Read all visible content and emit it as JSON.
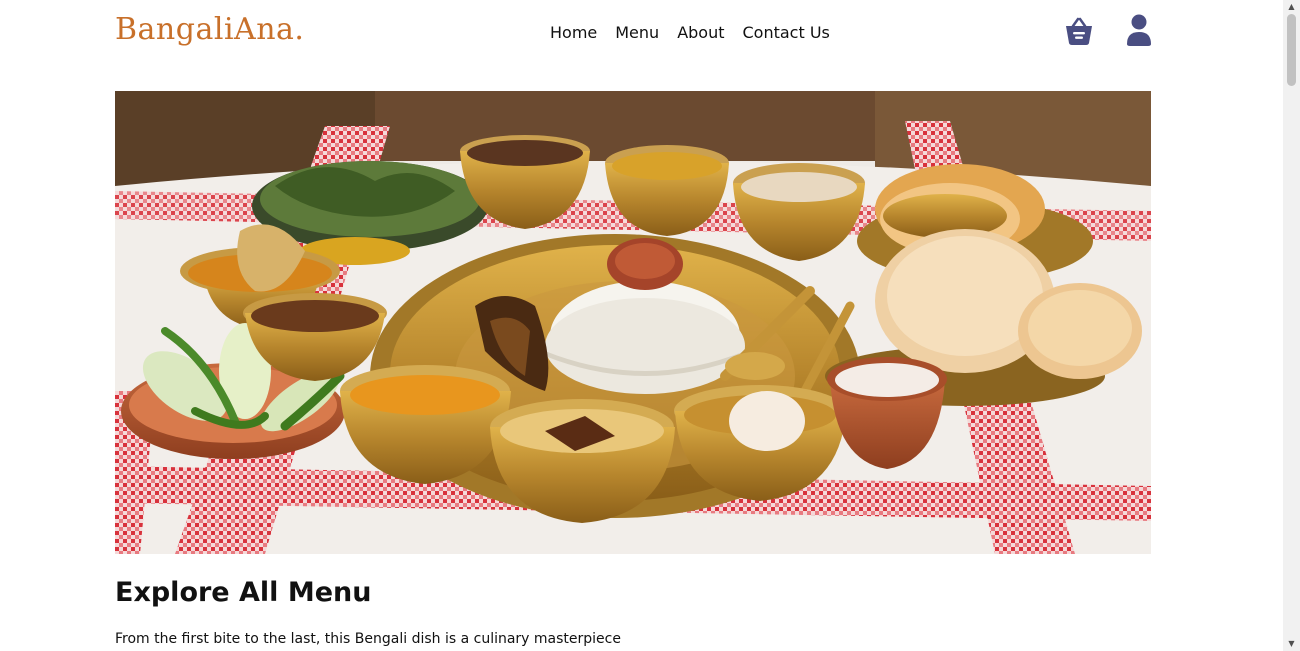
{
  "brand": {
    "name": "BangaliAna."
  },
  "nav": {
    "items": [
      "Home",
      "Menu",
      "About",
      "Contact Us"
    ]
  },
  "icons": {
    "cart": "shopping-basket-icon",
    "user": "user-icon"
  },
  "colors": {
    "brand": "#c8702a",
    "icon": "#4a4e82",
    "text": "#111111"
  },
  "hero": {
    "alt": "Bengali thali with rice, luchi and curries in brass bowls"
  },
  "section": {
    "title": "Explore All Menu",
    "description": "From the first bite to the last, this Bengali dish is a culinary masterpiece"
  }
}
